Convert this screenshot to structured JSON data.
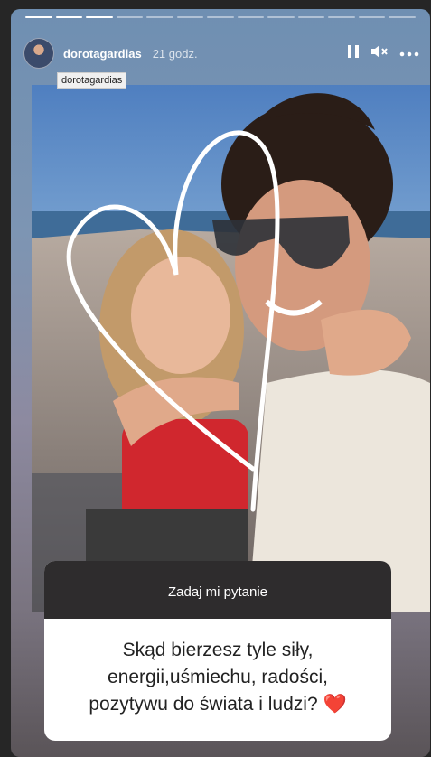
{
  "story": {
    "progress_total": 13,
    "progress_done": 3,
    "username": "dorotagardias",
    "time": "21 godz.",
    "tooltip": "dorotagardias",
    "icons": [
      "avatar",
      "pause-icon",
      "mute-icon",
      "more-icon"
    ],
    "photo": "Woman in sunglasses hugging a young girl on a beach, with a hand-drawn white heart sticker"
  },
  "question": {
    "header": "Zadaj mi pytanie",
    "line1": "Skąd bierzesz tyle siły,",
    "line2": "energii,uśmiechu, radości,",
    "line3": "pozytywu do świata i ludzi?",
    "emoji": "❤️"
  },
  "colors": {
    "heart": "#c9302c",
    "card_header": "#2e2c2d"
  }
}
